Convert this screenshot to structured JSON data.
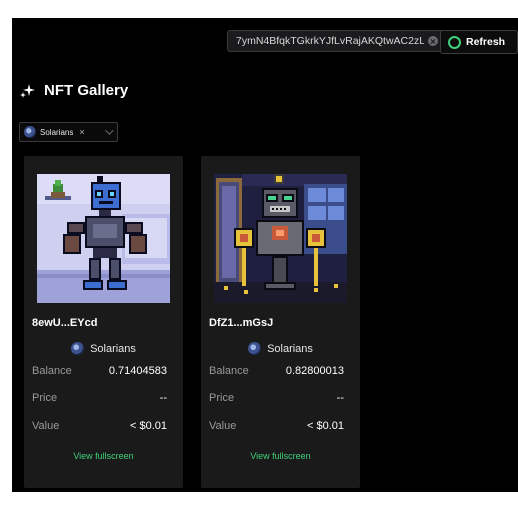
{
  "header": {
    "address_value": "7ymN4BfqkTGkrkYJfLvRajAKQtwAC2zL",
    "refresh_label": "Refresh"
  },
  "page": {
    "title": "NFT Gallery"
  },
  "filter": {
    "selected_label": "Solarians",
    "remove_glyph": "×"
  },
  "cards": [
    {
      "name": "8ewU...EYcd",
      "collection": "Solarians",
      "balance_label": "Balance",
      "balance_value": "0.71404583",
      "price_label": "Price",
      "price_value": "--",
      "value_label": "Value",
      "value_value": "< $0.01",
      "view_label": "View fullscreen"
    },
    {
      "name": "DfZ1...mGsJ",
      "collection": "Solarians",
      "balance_label": "Balance",
      "balance_value": "0.82800013",
      "price_label": "Price",
      "price_value": "--",
      "value_label": "Value",
      "value_value": "< $0.01",
      "view_label": "View fullscreen"
    }
  ],
  "colors": {
    "accent_green": "#3fd07a",
    "background": "#000000",
    "card_bg": "#1a1a1a"
  },
  "icons": {
    "refresh": "refresh-ring-icon",
    "title": "sparkle-icon",
    "clear": "clear-circle-icon",
    "caret": "chevron-down-icon",
    "collection": "solarians-avatar-icon"
  }
}
